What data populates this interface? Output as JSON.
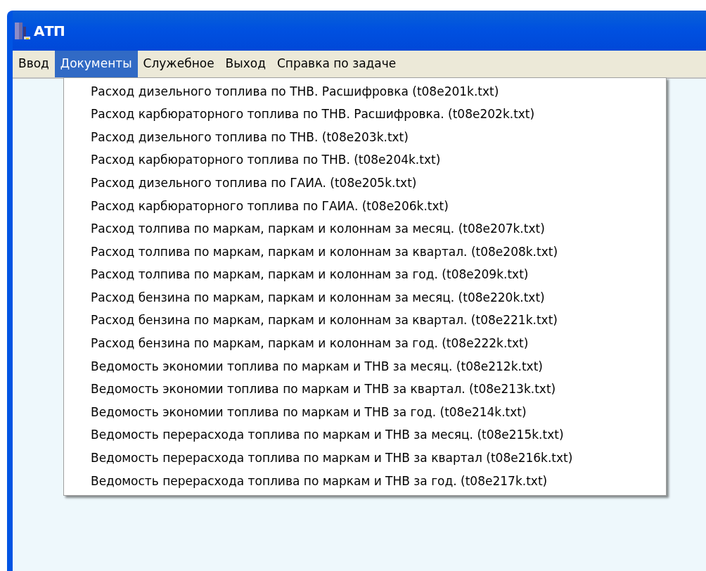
{
  "window": {
    "title": "АТП"
  },
  "menu": [
    {
      "label": "Ввод",
      "selected": false
    },
    {
      "label": "Документы",
      "selected": true
    },
    {
      "label": "Служебное",
      "selected": false
    },
    {
      "label": "Выход",
      "selected": false
    },
    {
      "label": "Справка по задаче",
      "selected": false
    }
  ],
  "dropdown": {
    "items": [
      "Расход дизельного топлива по ТНВ. Расшифровка (t08e201k.txt)",
      "Расход карбюраторного топлива по ТНВ. Расшифровка. (t08e202k.txt)",
      "Расход дизельного топлива по ТНВ. (t08e203k.txt)",
      "Расход карбюраторного топлива по ТНВ. (t08e204k.txt)",
      "Расход дизельного топлива по ГАИА. (t08e205k.txt)",
      "Расход карбюраторного топлива по ГАИА. (t08e206k.txt)",
      "Расход толпива по маркам, паркам и колоннам за месяц. (t08e207k.txt)",
      "Расход толпива по маркам, паркам и колоннам за квартал. (t08e208k.txt)",
      "Расход толпива по маркам, паркам и колоннам за год. (t08e209k.txt)",
      "Расход бензина по маркам, паркам и колоннам за месяц. (t08e220k.txt)",
      "Расход бензина по маркам, паркам и колоннам за квартал. (t08e221k.txt)",
      "Расход бензина по маркам, паркам и колоннам за год. (t08e222k.txt)",
      "Ведомость экономии топлива по маркам и ТНВ за месяц. (t08e212k.txt)",
      "Ведомость экономии топлива по маркам и ТНВ за квартал. (t08e213k.txt)",
      "Ведомость экономии топлива по маркам и ТНВ за год. (t08e214k.txt)",
      "Ведомость перерасхода топлива по маркам и ТНВ за месяц. (t08e215k.txt)",
      "Ведомость перерасхода топлива по маркам и ТНВ за квартал (t08e216k.txt)",
      "Ведомость перерасхода топлива по маркам и ТНВ за год. (t08e217k.txt)"
    ]
  }
}
